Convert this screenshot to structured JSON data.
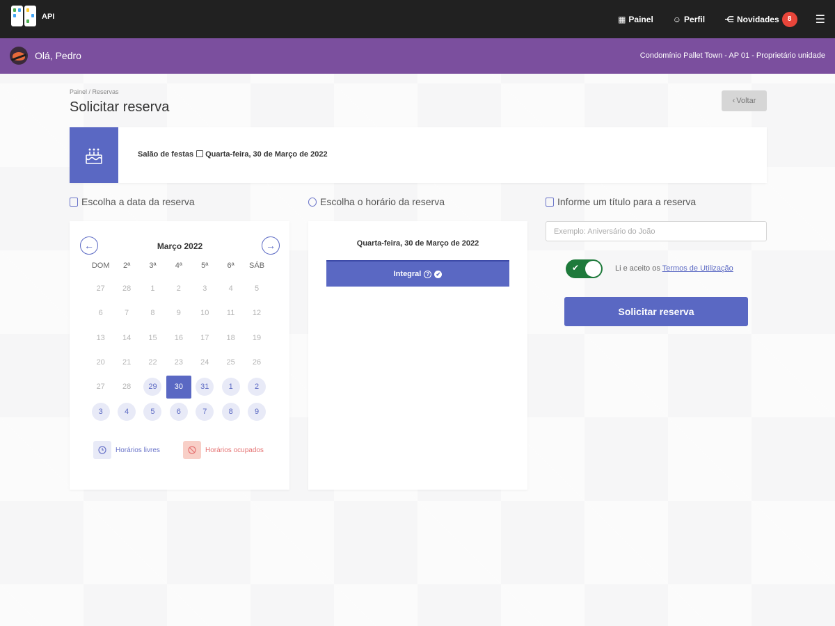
{
  "header": {
    "app_name": "API",
    "nav": [
      {
        "label": "Painel",
        "icon": "grid-icon"
      },
      {
        "label": "Perfil",
        "icon": "user-circle-icon"
      },
      {
        "label": "Novidades",
        "icon": "share-icon",
        "badge": "8"
      }
    ],
    "menu_icon": "hamburger-icon"
  },
  "userbar": {
    "greeting": "Olá, Pedro",
    "context": "Condomínio Pallet Town - AP 01 - Proprietário unidade"
  },
  "page": {
    "breadcrumb": "Painel  /  Reservas",
    "title": "Solicitar reserva",
    "back_label": "Voltar"
  },
  "info": {
    "area": "Salão de festas",
    "date": "Quarta-feira, 30 de Março de 2022",
    "icon": "cake-icon"
  },
  "sections": {
    "date_label": "Escolha a data da reserva",
    "time_label": "Escolha o horário da reserva",
    "title_label": "Informe um título para a reserva"
  },
  "calendar": {
    "month": "Março 2022",
    "weekdays": [
      "DOM",
      "2ª",
      "3ª",
      "4ª",
      "5ª",
      "6ª",
      "SÁB"
    ],
    "weeks": [
      [
        {
          "d": "27",
          "s": "off"
        },
        {
          "d": "28",
          "s": "off"
        },
        {
          "d": "1",
          "s": "off"
        },
        {
          "d": "2",
          "s": "off"
        },
        {
          "d": "3",
          "s": "off"
        },
        {
          "d": "4",
          "s": "off"
        },
        {
          "d": "5",
          "s": "off"
        }
      ],
      [
        {
          "d": "6",
          "s": "off"
        },
        {
          "d": "7",
          "s": "off"
        },
        {
          "d": "8",
          "s": "off"
        },
        {
          "d": "9",
          "s": "off"
        },
        {
          "d": "10",
          "s": "off"
        },
        {
          "d": "11",
          "s": "off"
        },
        {
          "d": "12",
          "s": "off"
        }
      ],
      [
        {
          "d": "13",
          "s": "off"
        },
        {
          "d": "14",
          "s": "off"
        },
        {
          "d": "15",
          "s": "off"
        },
        {
          "d": "16",
          "s": "off"
        },
        {
          "d": "17",
          "s": "off"
        },
        {
          "d": "18",
          "s": "off"
        },
        {
          "d": "19",
          "s": "off"
        }
      ],
      [
        {
          "d": "20",
          "s": "off"
        },
        {
          "d": "21",
          "s": "off"
        },
        {
          "d": "22",
          "s": "off"
        },
        {
          "d": "23",
          "s": "off"
        },
        {
          "d": "24",
          "s": "off"
        },
        {
          "d": "25",
          "s": "off"
        },
        {
          "d": "26",
          "s": "off"
        }
      ],
      [
        {
          "d": "27",
          "s": "off"
        },
        {
          "d": "28",
          "s": "off"
        },
        {
          "d": "29",
          "s": "avail"
        },
        {
          "d": "30",
          "s": "sel"
        },
        {
          "d": "31",
          "s": "avail"
        },
        {
          "d": "1",
          "s": "avail"
        },
        {
          "d": "2",
          "s": "avail"
        }
      ],
      [
        {
          "d": "3",
          "s": "avail"
        },
        {
          "d": "4",
          "s": "avail"
        },
        {
          "d": "5",
          "s": "avail"
        },
        {
          "d": "6",
          "s": "avail"
        },
        {
          "d": "7",
          "s": "avail"
        },
        {
          "d": "8",
          "s": "avail"
        },
        {
          "d": "9",
          "s": "avail"
        }
      ]
    ],
    "legend_free": "Horários livres",
    "legend_busy": "Horários ocupados"
  },
  "time": {
    "date": "Quarta-feira, 30 de Março de 2022",
    "slot_label": "Integral"
  },
  "form": {
    "title_placeholder": "Exemplo: Aniversário do João",
    "title_value": "",
    "terms_prefix": "Li e aceito os",
    "terms_link": "Termos de Utilização",
    "terms_accepted": true,
    "submit_label": "Solicitar reserva"
  },
  "colors": {
    "primary": "#5a68c3",
    "topbar": "#212121",
    "userbar": "#7b4f9e",
    "toggle_on": "#1e7a3b",
    "badge": "#e9453a"
  }
}
